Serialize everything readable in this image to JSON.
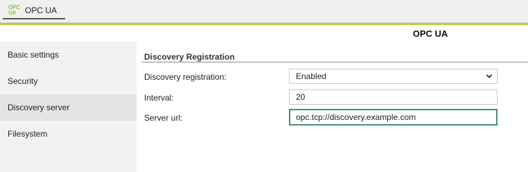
{
  "tab": {
    "logo_line1": "OPC",
    "logo_line2": "UA",
    "label": "OPC UA",
    "logo_color": "#8cc63f"
  },
  "accent_color": "#b0d236",
  "page_title": "OPC UA",
  "sidebar": {
    "items": [
      {
        "label": "Basic settings",
        "active": false
      },
      {
        "label": "Security",
        "active": false
      },
      {
        "label": "Discovery server",
        "active": true
      },
      {
        "label": "Filesystem",
        "active": false
      }
    ]
  },
  "section": {
    "title": "Discovery Registration",
    "fields": {
      "discovery_registration": {
        "label": "Discovery registration:",
        "value": "Enabled",
        "icon": "chevron-down-icon"
      },
      "interval": {
        "label": "Interval:",
        "value": "20"
      },
      "server_url": {
        "label": "Server url:",
        "value": "opc.tcp://discovery.example.com"
      }
    }
  }
}
